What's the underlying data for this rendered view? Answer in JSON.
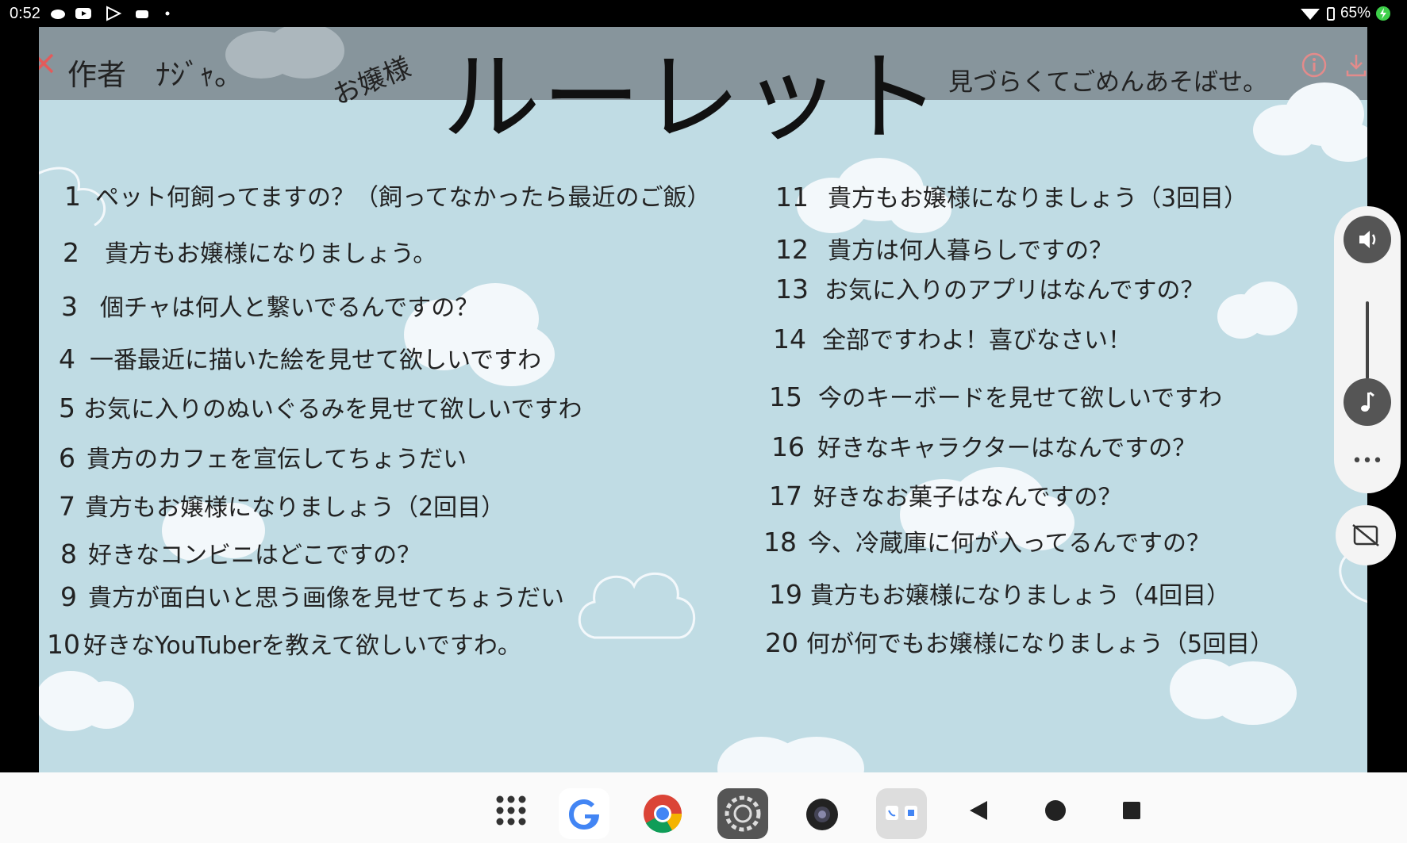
{
  "status_bar": {
    "time": "0:52",
    "battery": "65%"
  },
  "header": {
    "author": "作者　ﾅｼﾞｬ。",
    "subtitle": "お嬢様",
    "title": "ルーレット",
    "note": "見づらくてごめんあそばせ。",
    "close_icon": "close-icon",
    "info_icon": "info-icon",
    "download_icon": "download-icon"
  },
  "questions_left": [
    {
      "num": "1",
      "text": "ペット何飼ってますの？（飼ってなかったら最近のご飯）"
    },
    {
      "num": "2",
      "text": "貴方もお嬢様になりましょう。"
    },
    {
      "num": "3",
      "text": "個チャは何人と繋いでるんですの？"
    },
    {
      "num": "4",
      "text": "一番最近に描いた絵を見せて欲しいですわ"
    },
    {
      "num": "5",
      "text": "お気に入りのぬいぐるみを見せて欲しいですわ"
    },
    {
      "num": "6",
      "text": "貴方のカフェを宣伝してちょうだい"
    },
    {
      "num": "7",
      "text": "貴方もお嬢様になりましょう（2回目）"
    },
    {
      "num": "8",
      "text": "好きなコンビニはどこですの？"
    },
    {
      "num": "9",
      "text": "貴方が面白いと思う画像を見せてちょうだい"
    },
    {
      "num": "10",
      "text": "好きなYouTuberを教えて欲しいですわ。"
    }
  ],
  "questions_right": [
    {
      "num": "11",
      "text": "貴方もお嬢様になりましょう（3回目）"
    },
    {
      "num": "12",
      "text": "貴方は何人暮らしですの？"
    },
    {
      "num": "13",
      "text": "お気に入りのアプリはなんですの？"
    },
    {
      "num": "14",
      "text": "全部ですわよ！喜びなさい！"
    },
    {
      "num": "15",
      "text": "今のキーボードを見せて欲しいですわ"
    },
    {
      "num": "16",
      "text": "好きなキャラクターはなんですの？"
    },
    {
      "num": "17",
      "text": "好きなお菓子はなんですの？"
    },
    {
      "num": "18",
      "text": "今、冷蔵庫に何が入ってるんですの？"
    },
    {
      "num": "19",
      "text": "貴方もお嬢様になりましょう（4回目）"
    },
    {
      "num": "20",
      "text": "何が何でもお嬢様になりましょう（5回目）"
    }
  ],
  "side_panel": {
    "volume_icon": "volume-icon",
    "music_icon": "music-note-icon",
    "more_label": "•••",
    "caption_icon": "caption-off-icon"
  },
  "navbar": {
    "apps": [
      "apps-grid-icon",
      "google-icon",
      "chrome-icon",
      "settings-icon",
      "camera-icon",
      "phone-app-icon"
    ],
    "back_icon": "back-icon",
    "home_icon": "home-icon",
    "recents_icon": "recents-icon"
  },
  "colors": {
    "background": "#c0dce4",
    "header_band": "#87959c",
    "accent_red": "#e35b5b"
  }
}
